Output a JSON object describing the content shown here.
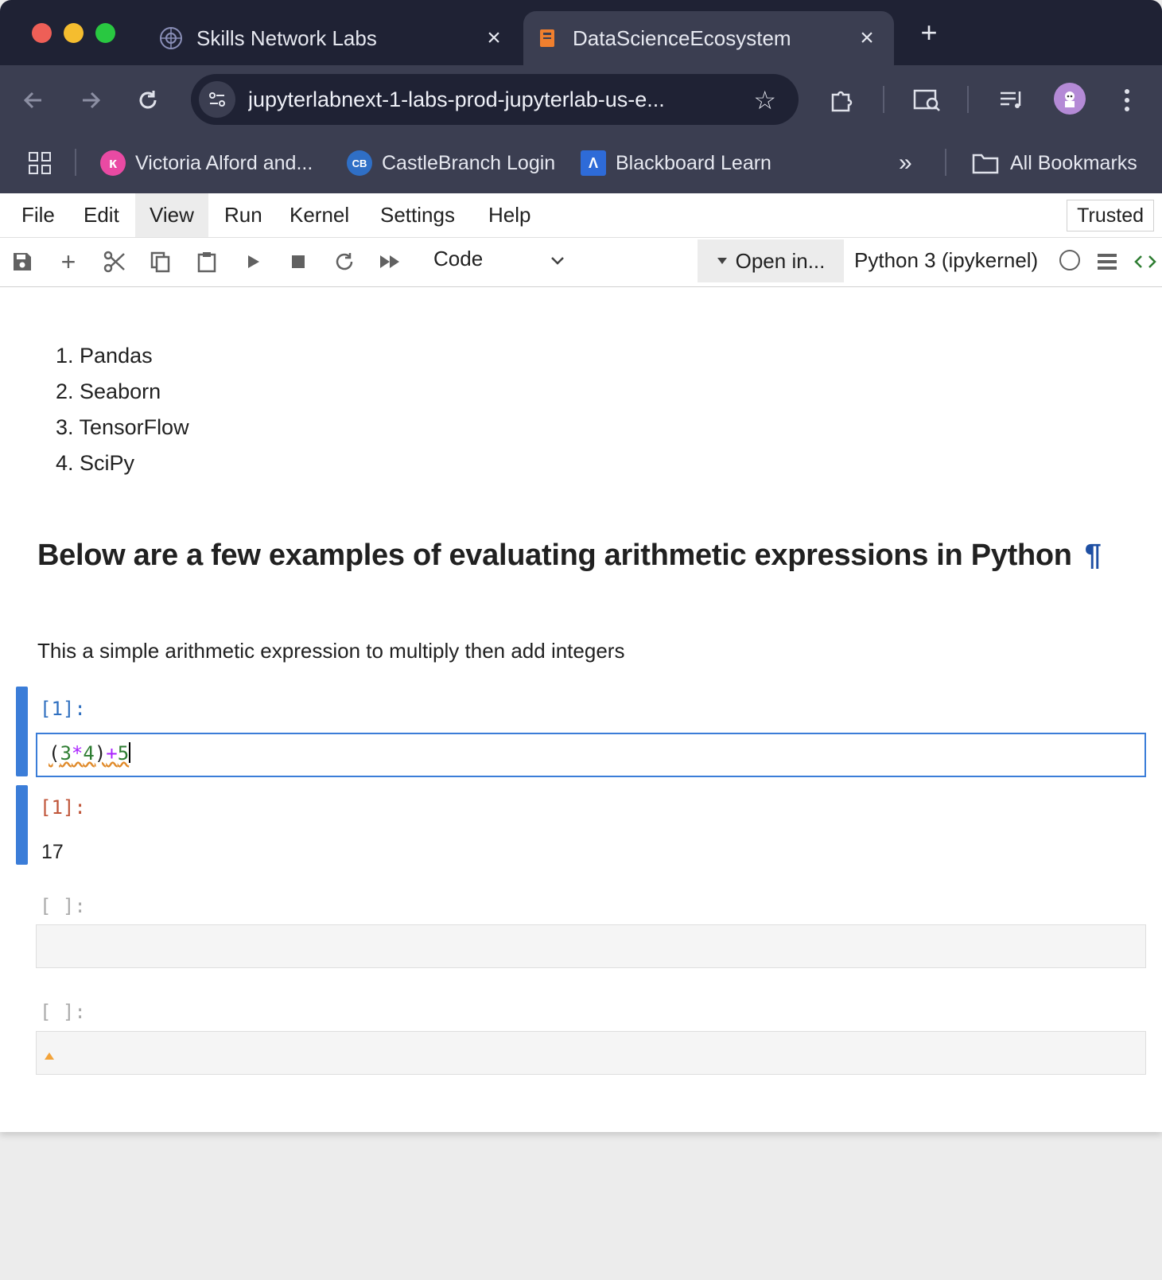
{
  "browser": {
    "tabs": [
      {
        "title": "Skills Network Labs",
        "icon": "skills-network-icon",
        "active": false
      },
      {
        "title": "DataScienceEcosystem",
        "icon": "jupyter-notebook-icon",
        "active": true
      }
    ],
    "url": "jupyterlabnext-1-labs-prod-jupyterlab-us-e...",
    "bookmarks": [
      {
        "label": "Victoria Alford and...",
        "icon": "pink-avatar-icon",
        "color": "#e94aa3"
      },
      {
        "label": "CastleBranch Login",
        "icon": "castlebranch-icon",
        "color": "#2f6fc6"
      },
      {
        "label": "Blackboard Learn",
        "icon": "blackboard-icon",
        "color": "#2e6bd8"
      }
    ],
    "all_bookmarks": "All Bookmarks",
    "overflow": "»"
  },
  "jupyter": {
    "menu": [
      "File",
      "Edit",
      "View",
      "Run",
      "Kernel",
      "Settings",
      "Help"
    ],
    "trusted": "Trusted",
    "cell_type": "Code",
    "open_in": "Open in...",
    "kernel": "Python 3 (ipykernel)"
  },
  "notebook": {
    "list": [
      "Pandas",
      "Seaborn",
      "TensorFlow",
      "SciPy"
    ],
    "heading": "Below are a few examples of evaluating arithmetic expressions in Python",
    "pilcrow": "¶",
    "paragraph": "This a simple arithmetic expression to multiply then add integers",
    "cell1_prompt": "[1]:",
    "cell1_code": {
      "open": "(",
      "a": "3",
      "op1": "*",
      "b": "4",
      "close": ")",
      "op2": "+",
      "c": "5"
    },
    "out1_prompt": "[1]:",
    "out1_value": "17",
    "cell2_prompt": "[ ]:",
    "cell3_prompt": "[ ]:"
  },
  "colors": {
    "accent": "#3b7dd8",
    "tab_bg": "#1f2234",
    "toolbar_bg": "#3b3e51"
  }
}
